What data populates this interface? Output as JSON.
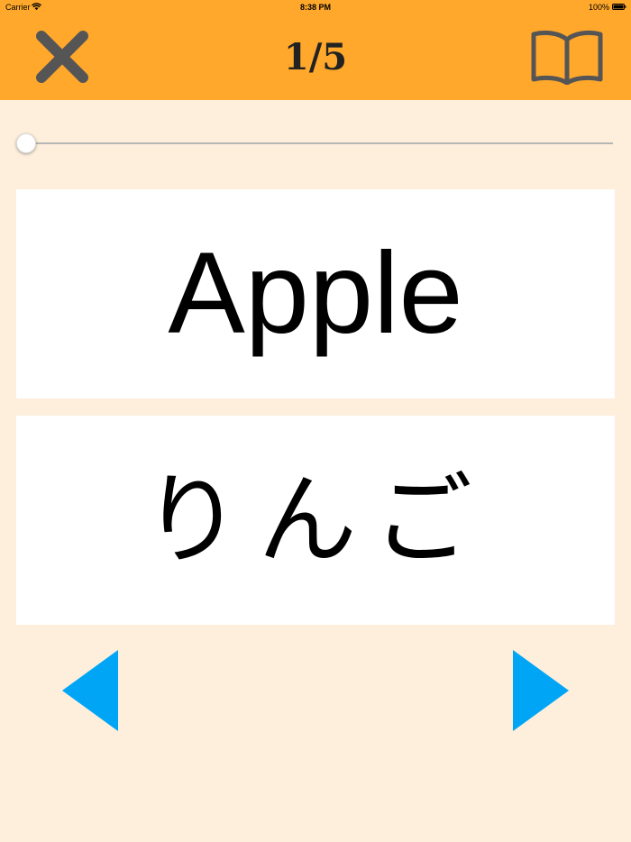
{
  "status_bar": {
    "carrier": "Carrier",
    "time": "8:38 PM",
    "battery": "100%"
  },
  "header": {
    "page_counter": "1/5",
    "close_icon": "close-icon",
    "book_icon": "book-icon",
    "background_color": "#FFA82B"
  },
  "progress": {
    "current": 1,
    "total": 5,
    "value": 0
  },
  "cards": {
    "front": "Apple",
    "back": "りんご"
  },
  "navigation": {
    "prev_icon": "triangle-left-icon",
    "next_icon": "triangle-right-icon",
    "arrow_color": "#00A6F5"
  },
  "colors": {
    "background": "#FDEFDC",
    "accent": "#FFA82B",
    "arrow": "#00A6F5",
    "icon": "#555555"
  }
}
